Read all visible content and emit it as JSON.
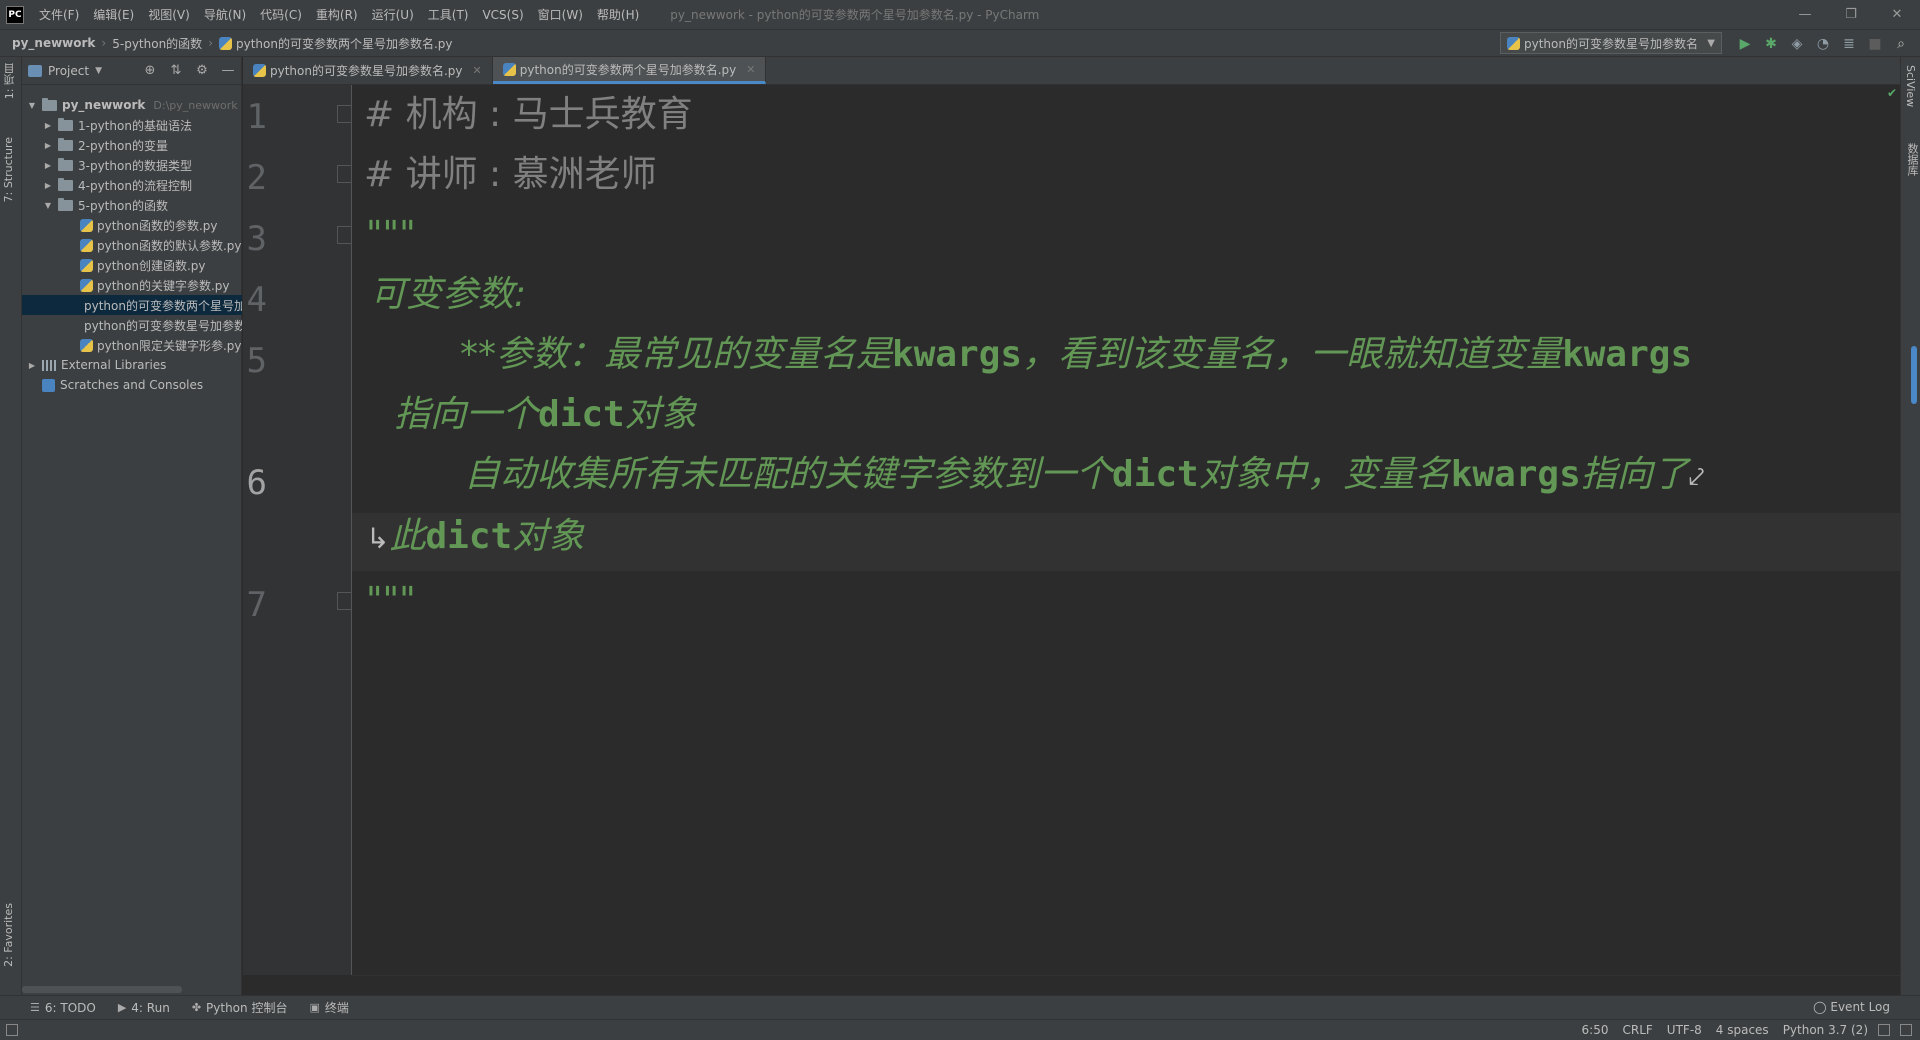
{
  "window": {
    "logo": "PC",
    "menu": [
      "文件(F)",
      "编辑(E)",
      "视图(V)",
      "导航(N)",
      "代码(C)",
      "重构(R)",
      "运行(U)",
      "工具(T)",
      "VCS(S)",
      "窗口(W)",
      "帮助(H)"
    ],
    "title": "py_newwork - python的可变参数两个星号加参数名.py - PyCharm",
    "controls": [
      "—",
      "❐",
      "✕"
    ]
  },
  "breadcrumb": {
    "project": "py_newwork",
    "folder": "5-python的函数",
    "file": "python的可变参数两个星号加参数名.py"
  },
  "run_config": {
    "label": "python的可变参数星号加参数名"
  },
  "left_strip": {
    "project_tab": "1: 项目",
    "structure_tab": "7: Structure",
    "favorites_tab": "2: Favorites"
  },
  "right_strip": {
    "sciview_tab": "SciView",
    "database_tab": "数据库"
  },
  "project_panel": {
    "title": "Project",
    "root": {
      "name": "py_newwork",
      "path": "D:\\py_newwork"
    },
    "folders": [
      "1-python的基础语法",
      "2-python的变量",
      "3-python的数据类型",
      "4-python的流程控制",
      "5-python的函数"
    ],
    "files": [
      "python函数的参数.py",
      "python函数的默认参数.py",
      "python创建函数.py",
      "python的关键字参数.py",
      "python的可变参数两个星号加参数名.py",
      "python的可变参数星号加参数名.py",
      "python限定关键字形参.py"
    ],
    "external_libraries": "External Libraries",
    "scratches": "Scratches and Consoles"
  },
  "tabs": [
    {
      "label": "python的可变参数星号加参数名.py"
    },
    {
      "label": "python的可变参数两个星号加参数名.py"
    }
  ],
  "editor": {
    "line_numbers": [
      "1",
      "2",
      "3",
      "4",
      "5",
      "6",
      "7"
    ],
    "line1": "# 机构 : 马士兵教育",
    "line2": "# 讲师 :  慕洲老师",
    "line3": "\"\"\"",
    "line4": "可变参数:",
    "line5a": "**参数：最常见的变量名是",
    "line5b": "kwargs",
    "line5c": "，看到该变量名，一眼就知道变量",
    "line5d": "kwargs",
    "line5e": "指向一个",
    "line5f": "dict",
    "line5g": "对象",
    "line6a": "自动收集所有未匹配的关键字参数到一个",
    "line6b": "dict",
    "line6c": "对象中，变量名",
    "line6d": "kwargs",
    "line6e": "指向了",
    "line6f": "此",
    "line6g": "dict",
    "line6h": "对象",
    "line7": "\"\"\""
  },
  "tool_tabs": [
    {
      "icon": "☰",
      "label": "6: TODO"
    },
    {
      "icon": "▶",
      "label": "4: Run"
    },
    {
      "icon": "✤",
      "label": "Python 控制台"
    },
    {
      "icon": "▣",
      "label": "终端"
    }
  ],
  "event_log": "Event Log",
  "status": {
    "position": "6:50",
    "line_sep": "CRLF",
    "encoding": "UTF-8",
    "indent": "4 spaces",
    "interpreter": "Python 3.7 (2)"
  }
}
